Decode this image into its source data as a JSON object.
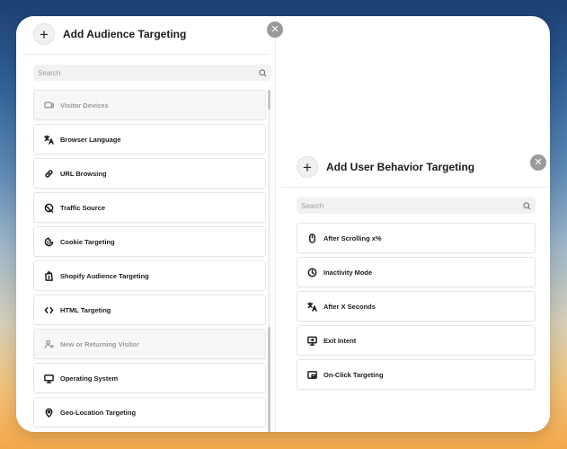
{
  "audience_panel": {
    "title": "Add Audience Targeting",
    "add_symbol": "+",
    "close_symbol": "✕",
    "search_placeholder": "Search",
    "items": [
      {
        "label": "Visitor Devices",
        "icon": "devices-icon",
        "dimmed": true
      },
      {
        "label": "Browser Language",
        "icon": "translate-icon",
        "dimmed": false
      },
      {
        "label": "URL Browsing",
        "icon": "link-icon",
        "dimmed": false
      },
      {
        "label": "Traffic Source",
        "icon": "traffic-source-icon",
        "dimmed": false
      },
      {
        "label": "Cookie Targeting",
        "icon": "cookie-icon",
        "dimmed": false
      },
      {
        "label": "Shopify Audience Targeting",
        "icon": "shopify-bag-icon",
        "dimmed": false
      },
      {
        "label": "HTML Targeting",
        "icon": "code-icon",
        "dimmed": false
      },
      {
        "label": "New or Returning Visitor",
        "icon": "returning-user-icon",
        "dimmed": true
      },
      {
        "label": "Operating System",
        "icon": "monitor-icon",
        "dimmed": false
      },
      {
        "label": "Geo-Location Targeting",
        "icon": "location-pin-icon",
        "dimmed": false
      }
    ]
  },
  "behavior_panel": {
    "title": "Add User Behavior Targeting",
    "add_symbol": "+",
    "close_symbol": "✕",
    "search_placeholder": "Search",
    "items": [
      {
        "label": "After Scrolling x%",
        "icon": "mouse-icon"
      },
      {
        "label": "Inactivity Mode",
        "icon": "clock-icon"
      },
      {
        "label": "After X Seconds",
        "icon": "translate-icon"
      },
      {
        "label": "Exit Intent",
        "icon": "exit-screen-icon"
      },
      {
        "label": "On-Click Targeting",
        "icon": "click-window-icon"
      }
    ]
  }
}
